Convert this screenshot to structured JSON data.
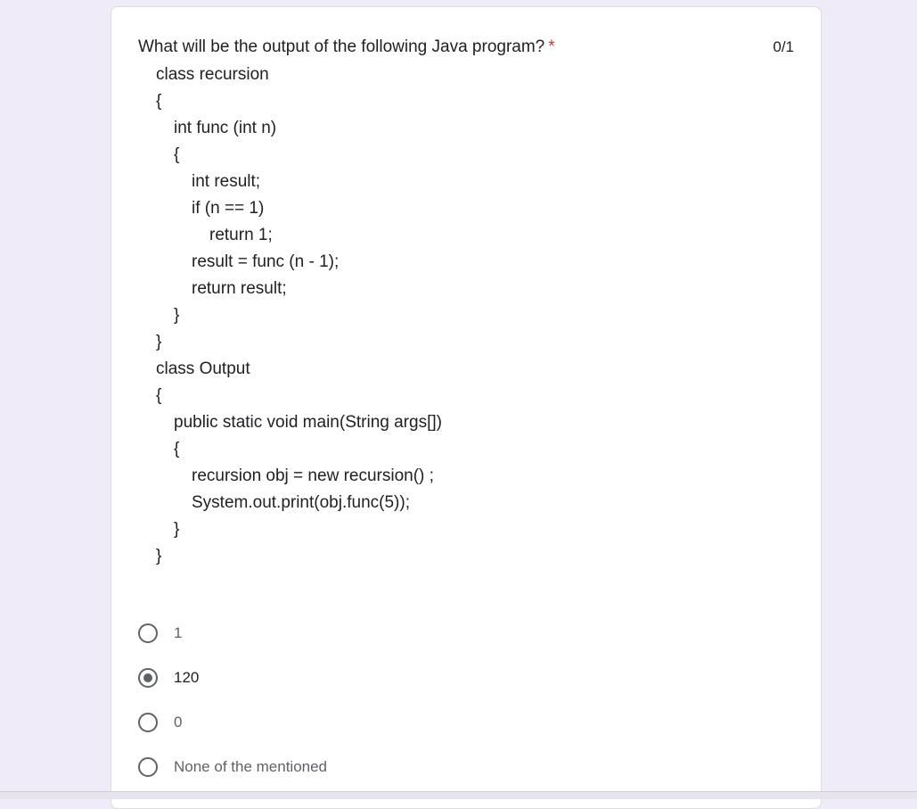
{
  "question": {
    "title": "What will be the output of the following Java program?",
    "required_mark": "*",
    "score": "0/1",
    "code_lines": [
      {
        "indent": 0,
        "text": "class recursion"
      },
      {
        "indent": 0,
        "text": "{"
      },
      {
        "indent": 1,
        "text": "int func (int n)"
      },
      {
        "indent": 1,
        "text": "{"
      },
      {
        "indent": 2,
        "text": "int result;"
      },
      {
        "indent": 2,
        "text": "if (n == 1)"
      },
      {
        "indent": 3,
        "text": "return 1;"
      },
      {
        "indent": 2,
        "text": "result = func (n - 1);"
      },
      {
        "indent": 2,
        "text": "return result;"
      },
      {
        "indent": 1,
        "text": "}"
      },
      {
        "indent": 0,
        "text": "}"
      },
      {
        "indent": 0,
        "text": "class Output"
      },
      {
        "indent": 0,
        "text": "{"
      },
      {
        "indent": 1,
        "text": "public static void main(String args[])"
      },
      {
        "indent": 1,
        "text": "{"
      },
      {
        "indent": 2,
        "text": "recursion obj = new recursion() ;"
      },
      {
        "indent": 2,
        "text": "System.out.print(obj.func(5));"
      },
      {
        "indent": 1,
        "text": "}"
      },
      {
        "indent": 0,
        "text": "}"
      }
    ]
  },
  "options": [
    {
      "label": "1",
      "selected": false
    },
    {
      "label": "120",
      "selected": true
    },
    {
      "label": "0",
      "selected": false
    },
    {
      "label": "None of the mentioned",
      "selected": false
    }
  ],
  "colors": {
    "page_background": "#f0ebf8",
    "required": "#d93025",
    "text_primary": "#202124",
    "text_secondary": "#5f6368"
  }
}
